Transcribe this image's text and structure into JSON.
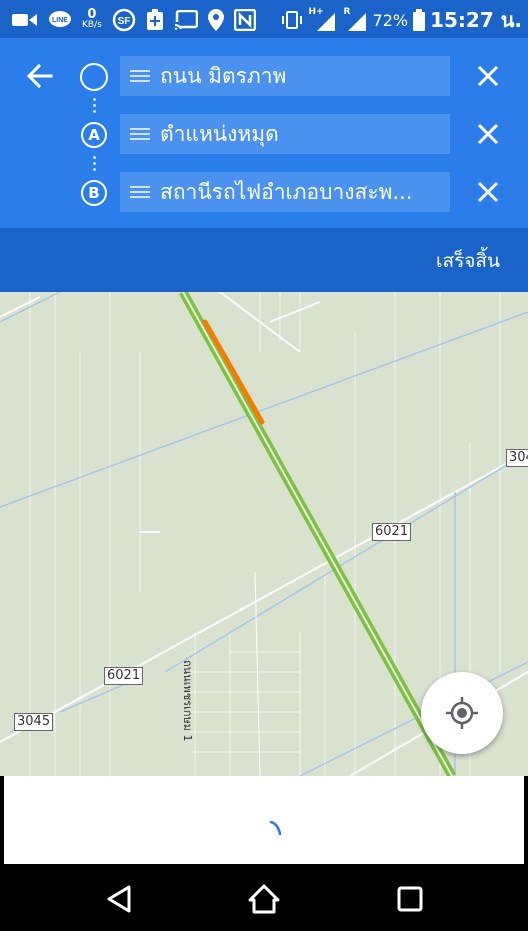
{
  "status_bar": {
    "kbs_value": "0",
    "kbs_unit": "KB/s",
    "network_type": "H+",
    "roaming_mark": "R",
    "battery": "72%",
    "time": "15:27 น.",
    "icons": [
      "video-camera-icon",
      "line-app-icon",
      "sf-icon",
      "battery-plus-icon",
      "cast-icon",
      "location-pin-icon",
      "nfc-icon",
      "vibrate-icon",
      "signal-icon",
      "signal-roaming-icon",
      "battery-icon"
    ]
  },
  "route": {
    "back_icon": "arrow-left-icon",
    "stops": [
      {
        "marker": "",
        "label": "ถนน มิตรภาพ"
      },
      {
        "marker": "A",
        "label": "ตำแหน่งหมุด"
      },
      {
        "marker": "B",
        "label": "สถานีรถไฟอำเภอบางสะพ..."
      }
    ],
    "remove_icon": "close-icon",
    "done_label": "เสร็จสิ้น"
  },
  "map": {
    "shields": [
      "304",
      "6021",
      "6021",
      "3045"
    ],
    "road_name": "ถนนเพชรเกษม 1",
    "locate_icon": "my-location-icon",
    "colors": {
      "route_green": "#7cc142",
      "traffic_orange": "#f57c00",
      "land": "#d9e2cf"
    }
  },
  "navigation_bar": {
    "icons": [
      "back-triangle-icon",
      "home-icon",
      "recents-square-icon"
    ]
  }
}
